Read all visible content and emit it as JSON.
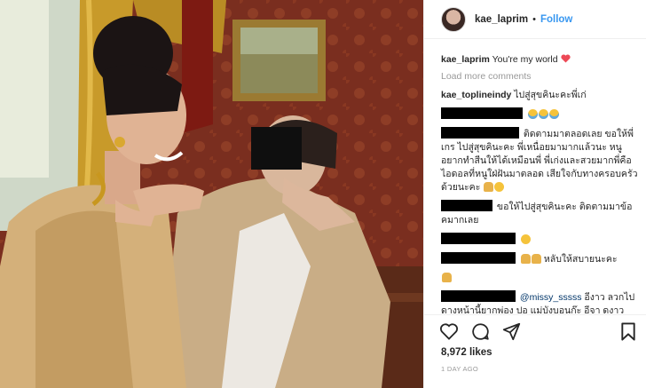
{
  "post": {
    "author": "kae_laprim",
    "follow_label": "Follow",
    "dot": "•",
    "caption_text": "You're my world",
    "load_more": "Load more comments",
    "comments": [
      {
        "user": "kae_toplineindy",
        "text": "ไปสู่สุขคินะคะพี่เก่"
      },
      {
        "user": "",
        "text": "ติดตามมาตลอดเลย ขอให้พี่เกร ไปสู่สุขคินะคะ พี่เหนื่อยมามากแล้วนะ หนูอยากทำสีนให้ได้เหมือนพี่ พี่เก่งและสวยมากพี่คือไอดอลที่หนูใฝ่ฝันมาตลอด เสียใจกับทางครอบครัวด้วยนะคะ"
      },
      {
        "user": "",
        "text": "ขอให้ไปสู่สุขคินะคะ ติดตามมาข้อคมากเลย"
      },
      {
        "user": "",
        "text": ""
      },
      {
        "user": "",
        "text": "หลับให้สบายนะคะ"
      },
      {
        "user": "",
        "text": ""
      },
      {
        "user": "",
        "mention": "@missy_sssss",
        "text": "อีงาว ลวกไป ดางหน้านี้ยากพ่อง ปอ แม่บังบอนก๊ะ อีจา ดงาว"
      }
    ],
    "likes": "8,972 likes",
    "time_ago": "1 DAY AGO"
  },
  "colors": {
    "accent": "#3897f0",
    "heart": "#ed4956",
    "muted": "#999999"
  },
  "icons": [
    "heart-icon",
    "comment-icon",
    "share-icon",
    "bookmark-icon"
  ]
}
